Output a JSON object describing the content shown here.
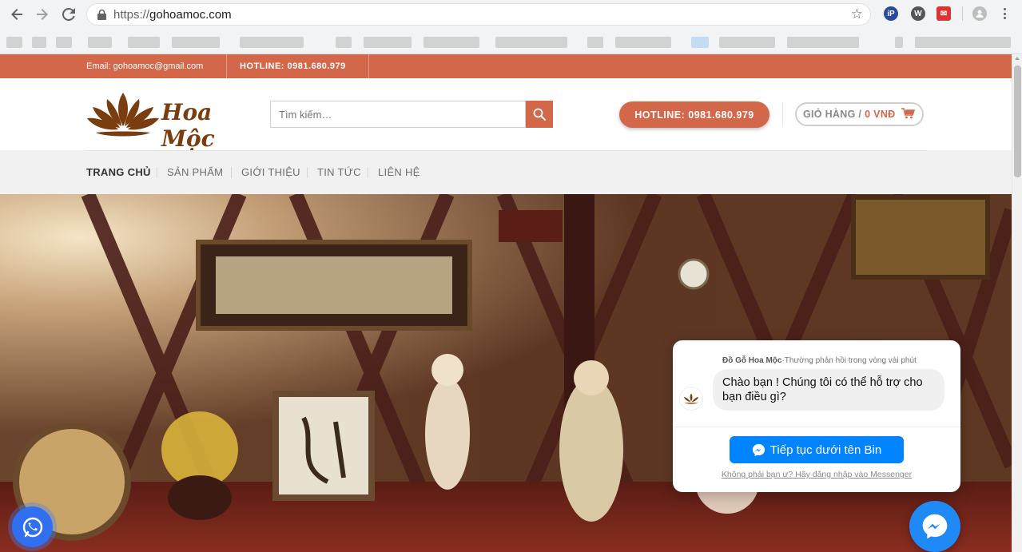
{
  "browser": {
    "url_scheme": "https://",
    "url_host": "gohoamoc.com",
    "icons": [
      "back-icon",
      "forward-icon",
      "reload-icon",
      "lock-icon",
      "star-icon",
      "profile-icon",
      "menu-icon"
    ]
  },
  "topbar": {
    "email": "Email: gohoamoc@gmail.com",
    "hotline": "HOTLINE: 0981.680.979",
    "background": "#d2674a"
  },
  "header": {
    "logo_text": "Hoa Mộc",
    "search_placeholder": "Tìm kiếm…",
    "hotline_button": "HOTLINE: 0981.680.979",
    "cart_label": "GIỎ HÀNG /",
    "cart_amount": "0 VNĐ",
    "accent_color": "#d2674a"
  },
  "nav": {
    "items": [
      {
        "label": "TRANG CHỦ",
        "active": true
      },
      {
        "label": "SẢN PHẨM",
        "active": false
      },
      {
        "label": "GIỚI THIỆU",
        "active": false
      },
      {
        "label": "TIN TỨC",
        "active": false
      },
      {
        "label": "LIÊN HỆ",
        "active": false
      }
    ]
  },
  "messenger": {
    "page_name": "Đồ Gỗ Hoa Mộc",
    "response_time": "·Thường phản hồi trong vòng vài phút",
    "greeting": "Chào bạn ! Chúng tôi có thể hỗ trợ cho bạn điều gì?",
    "continue_button": "Tiếp tục dưới tên Bin",
    "login_link": "Không phải bạn ư? Hãy đăng nhập vào Messenger",
    "brand_color": "#0084ff"
  }
}
